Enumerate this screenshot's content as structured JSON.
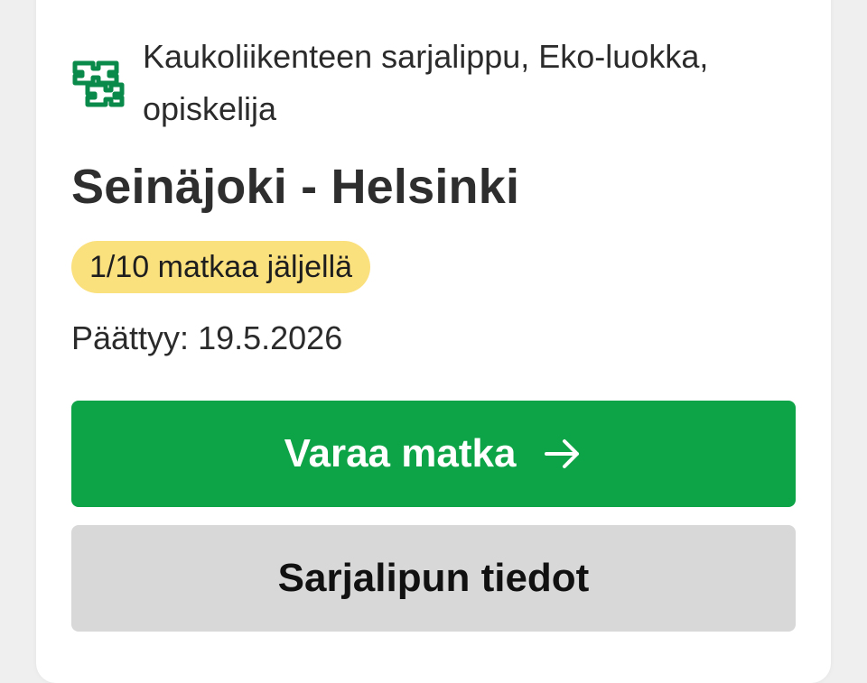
{
  "ticket": {
    "type_label": "Kaukoliikenteen sarjalippu, Eko-luokka, opiskelija",
    "route": "Seinäjoki - Helsinki",
    "trips_remaining": "1/10 matkaa jäljellä",
    "expiry": "Päättyy: 19.5.2026",
    "logo_icon": "vr-logo-icon"
  },
  "actions": {
    "book_label": "Varaa matka",
    "book_icon": "arrow-right-icon",
    "details_label": "Sarjalipun tiedot"
  },
  "colors": {
    "brand_green": "#0da347",
    "badge_yellow": "#fbe07e",
    "secondary_gray": "#d8d8d8"
  }
}
